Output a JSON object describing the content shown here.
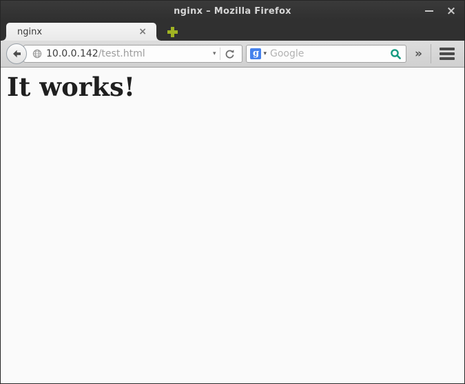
{
  "window": {
    "title": "nginx – Mozilla Firefox"
  },
  "titlebar": {
    "minimize_icon": "minimize-icon",
    "close_glyph": "×"
  },
  "tab_strip": {
    "active_tab": {
      "label": "nginx",
      "close_glyph": "×"
    },
    "new_tab_icon": "plus-icon"
  },
  "toolbar": {
    "back_icon": "back-arrow-icon",
    "url": {
      "host": "10.0.0.142",
      "path": "/test.html"
    },
    "url_dropdown_glyph": "▾",
    "reload_icon": "reload-icon",
    "search": {
      "favicon_letter": "g",
      "dropdown_glyph": "▾",
      "placeholder": "Google",
      "magnifier_icon": "search-icon"
    },
    "overflow_glyph": "»",
    "menu_icon": "hamburger-menu-icon"
  },
  "page": {
    "heading": "It works!"
  },
  "colors": {
    "chrome_dark": "#303030",
    "toolbar_bg": "#d6d6d6",
    "new_tab_green": "#a0b322",
    "magnifier_teal": "#149a80",
    "google_blue": "#4581ec",
    "page_bg": "#fafafa"
  }
}
